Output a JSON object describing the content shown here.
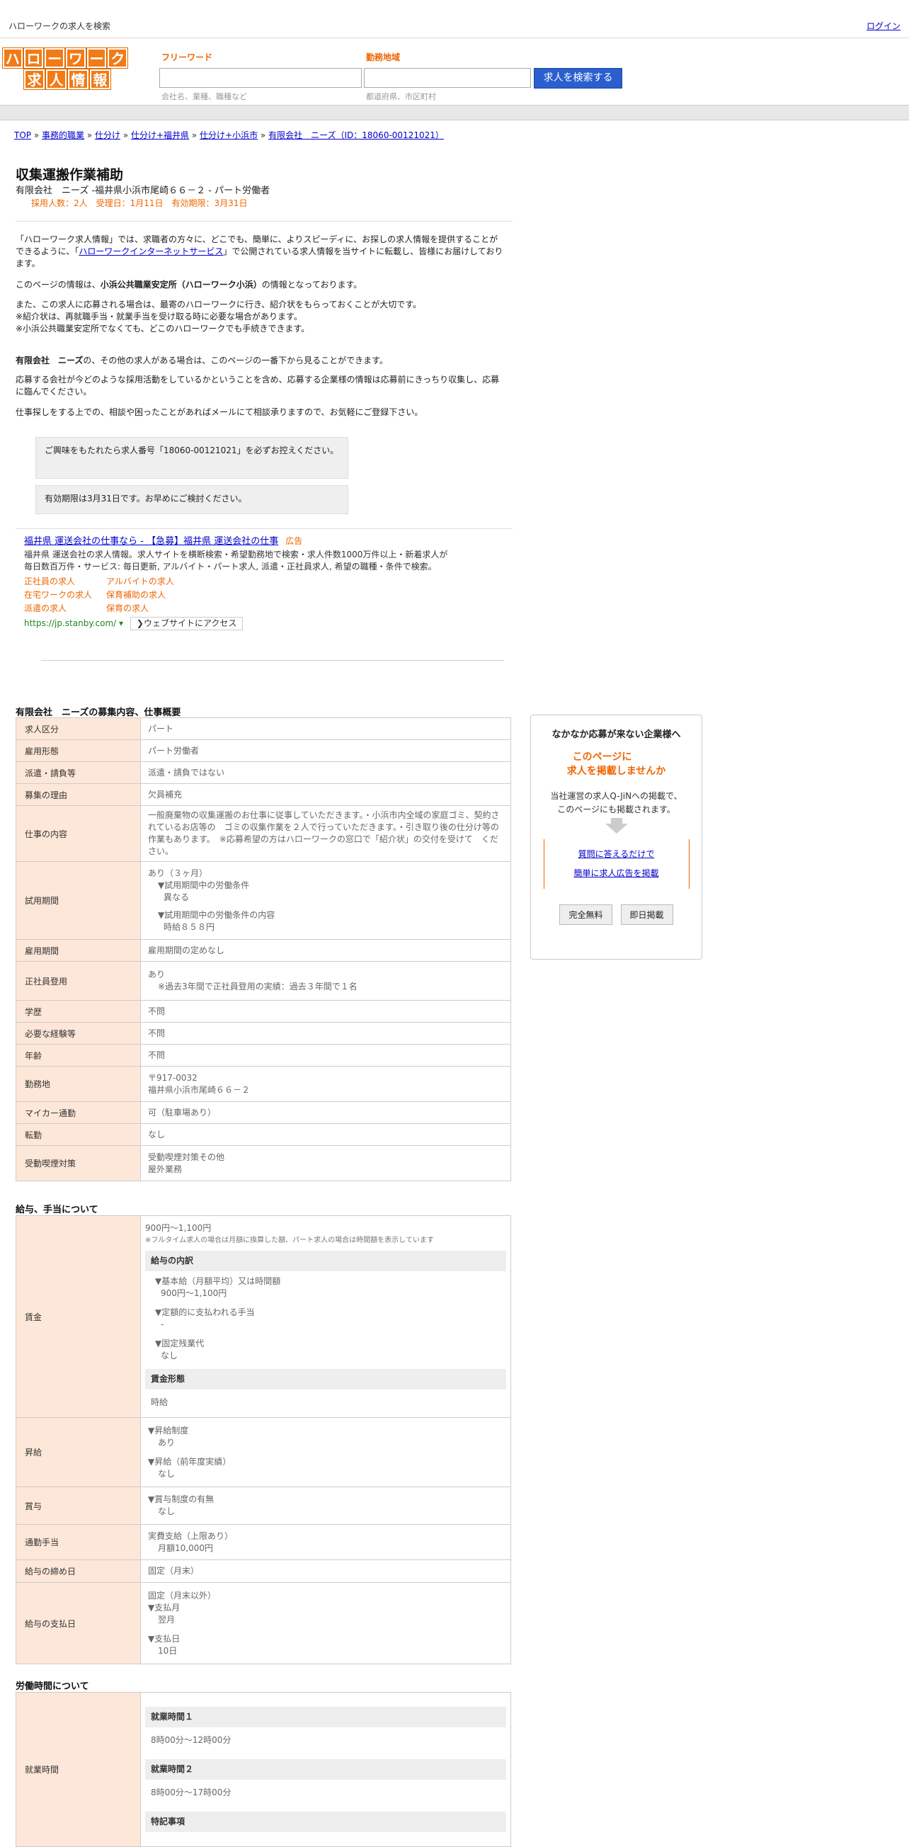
{
  "topbar": {
    "title": "ハローワークの求人を検索",
    "login": "ログイン"
  },
  "logo": {
    "row1": [
      "ハ",
      "ロ",
      "ー",
      "ワ",
      "ー",
      "ク"
    ],
    "row2": [
      "求",
      "人",
      "情",
      "報"
    ]
  },
  "search": {
    "free_label": "フリーワード",
    "free_placeholder": "会社名、業種、職種など",
    "area_label": "勤務地域",
    "area_placeholder": "都道府県、市区町村",
    "button": "求人を検索する"
  },
  "breadcrumb": {
    "items": [
      "TOP",
      "事務的職業",
      "仕分け",
      "仕分け+福井県",
      "仕分け+小浜市",
      "有限会社　ニーズ（ID：18060-00121021）"
    ],
    "sep": " » "
  },
  "job": {
    "title": "収集運搬作業補助",
    "subtitle": "有限会社　ニーズ -福井県小浜市尾崎６６－２ - パート労働者",
    "meta": "採用人数：2人　受理日：1月11日　有効期限：3月31日"
  },
  "intro": {
    "p1_a": "「ハローワーク求人情報」では、求職者の方々に、どこでも、簡単に、よりスピーディに、お探しの求人情報を提供することができるように、「",
    "p1_link": "ハローワークインターネットサービス",
    "p1_b": "」で公開されている求人情報を当サイトに転載し、皆様にお届けしております。",
    "p2_a": "このページの情報は、",
    "p2_bold": "小浜公共職業安定所（ハローワーク小浜）",
    "p2_b": "の情報となっております。",
    "p3_l1": "また、この求人に応募される場合は、最寄のハローワークに行き、紹介状をもらっておくことが大切です。",
    "p3_l2": "※紹介状は、再就職手当・就業手当を受け取る時に必要な場合があります。",
    "p3_l3": "※小浜公共職業安定所でなくても、どこのハローワークでも手続きできます。",
    "p4_bold": "有限会社　ニーズ",
    "p4_b": "の、その他の求人がある場合は、このページの一番下から見ることができます。",
    "p5": "応募する会社が今どのような採用活動をしているかということを含め、応募する企業様の情報は応募前にきっちり収集し、応募に臨んでください。",
    "p6": "仕事探しをする上での、相談や困ったことがあればメールにて相談承りますので、お気軽にご登録下さい。",
    "note1": "ご興味をもたれたら求人番号「18060-00121021」を必ずお控えください。",
    "note2": "有効期限は3月31日です。お早めにご検討ください。"
  },
  "ad": {
    "title": "福井県 運送会社の仕事なら - 【急募】福井県 運送会社の仕事",
    "tag": "広告",
    "desc": "福井県 運送会社の求人情報。求人サイトを横断検索・希望勤務地で検索・求人件数1000万件以上・新着求人が毎日数百万件・サービス: 毎日更新, アルバイト・パート求人, 派遣・正社員求人, 希望の職種・条件で検索。",
    "links": [
      "正社員の求人",
      "アルバイトの求人",
      "在宅ワークの求人",
      "保育補助の求人",
      "派遣の求人",
      "保育の求人"
    ],
    "url": "https://jp.stanby.com/",
    "url_marker": "▾",
    "visit": "❯ウェブサイトにアクセス"
  },
  "section1": {
    "title": "有限会社　ニーズの募集内容、仕事概要",
    "rows": [
      {
        "k": "求人区分",
        "v": "パート"
      },
      {
        "k": "雇用形態",
        "v": "パート労働者"
      },
      {
        "k": "派遣・請負等",
        "v": "派遣・請負ではない"
      },
      {
        "k": "募集の理由",
        "v": "欠員補充"
      },
      {
        "k": "仕事の内容",
        "v": "一般廃棄物の収集運搬のお仕事に従事していただきます。・小浜市内全域の家庭ゴミ、契約されているお店等の　ゴミの収集作業を２人で行っていただきます。・引き取り後の仕分け等の作業もあります。　※応募希望の方はハローワークの窓口で「紹介状」の交付を受けて　ください。"
      },
      {
        "k": "試用期間",
        "v1": "あり（３ヶ月）",
        "v2": "▼試用期間中の労働条件",
        "v3": "異なる",
        "v4": "▼試用期間中の労働条件の内容",
        "v5": "時給８５８円"
      },
      {
        "k": "雇用期間",
        "v": "雇用期間の定めなし"
      },
      {
        "k": "正社員登用",
        "v1": "あり",
        "v2": "※過去3年間で正社員登用の実績：過去３年間で１名"
      },
      {
        "k": "学歴",
        "v": "不問"
      },
      {
        "k": "必要な経験等",
        "v": "不問"
      },
      {
        "k": "年齢",
        "v": "不問"
      },
      {
        "k": "勤務地",
        "v1": "〒917-0032",
        "v2": "福井県小浜市尾崎６６－２"
      },
      {
        "k": "マイカー通勤",
        "v": "可（駐車場あり）"
      },
      {
        "k": "転勤",
        "v": "なし"
      },
      {
        "k": "受動喫煙対策",
        "v1": "受動喫煙対策その他",
        "v2": "屋外業務"
      }
    ]
  },
  "section2": {
    "title": "給与、手当について",
    "wage": {
      "k": "賃金",
      "range": "900円〜1,100円",
      "note": "※フルタイム求人の場合は月額に換算した額、パート求人の場合は時間額を表示しています",
      "breakdown_h": "給与の内訳",
      "b1": "▼基本給（月額平均）又は時間額",
      "b1v": "900円〜1,100円",
      "b2": "▼定額的に支払われる手当",
      "b2v": "-",
      "b3": "▼固定残業代",
      "b3v": "なし",
      "form_h": "賃金形態",
      "form_v": "時給"
    },
    "raise": {
      "k": "昇給",
      "a": "▼昇給制度",
      "av": "あり",
      "b": "▼昇給（前年度実績）",
      "bv": "なし"
    },
    "bonus": {
      "k": "賞与",
      "a": "▼賞与制度の有無",
      "av": "なし"
    },
    "commute": {
      "k": "通勤手当",
      "a": "実費支給（上限あり）",
      "av": "月額10,000円"
    },
    "cutoff": {
      "k": "給与の締め日",
      "v": "固定（月末）"
    },
    "payday": {
      "k": "給与の支払日",
      "a": "固定（月末以外）",
      "b": "▼支払月",
      "bv": "翌月",
      "c": "▼支払日",
      "cv": "10日"
    }
  },
  "section3": {
    "title": "労働時間について",
    "hours": {
      "k": "就業時間",
      "h1": "就業時間１",
      "v1": "8時00分〜12時00分",
      "h2": "就業時間２",
      "v2": "8時00分〜17時00分",
      "h3": "特記事項"
    }
  },
  "side": {
    "heading": "なかなか応募が来ない企業様へ",
    "offer_l1": "このページに",
    "offer_l2": "求人を掲載しませんか",
    "text_l1": "当社運営の求人Q-JiNへの掲載で、",
    "text_l2": "このページにも掲載されます。",
    "link1": "質問に答えるだけで",
    "link2": "簡単に求人広告を掲載",
    "btn1": "完全無料",
    "btn2": "即日掲載"
  }
}
